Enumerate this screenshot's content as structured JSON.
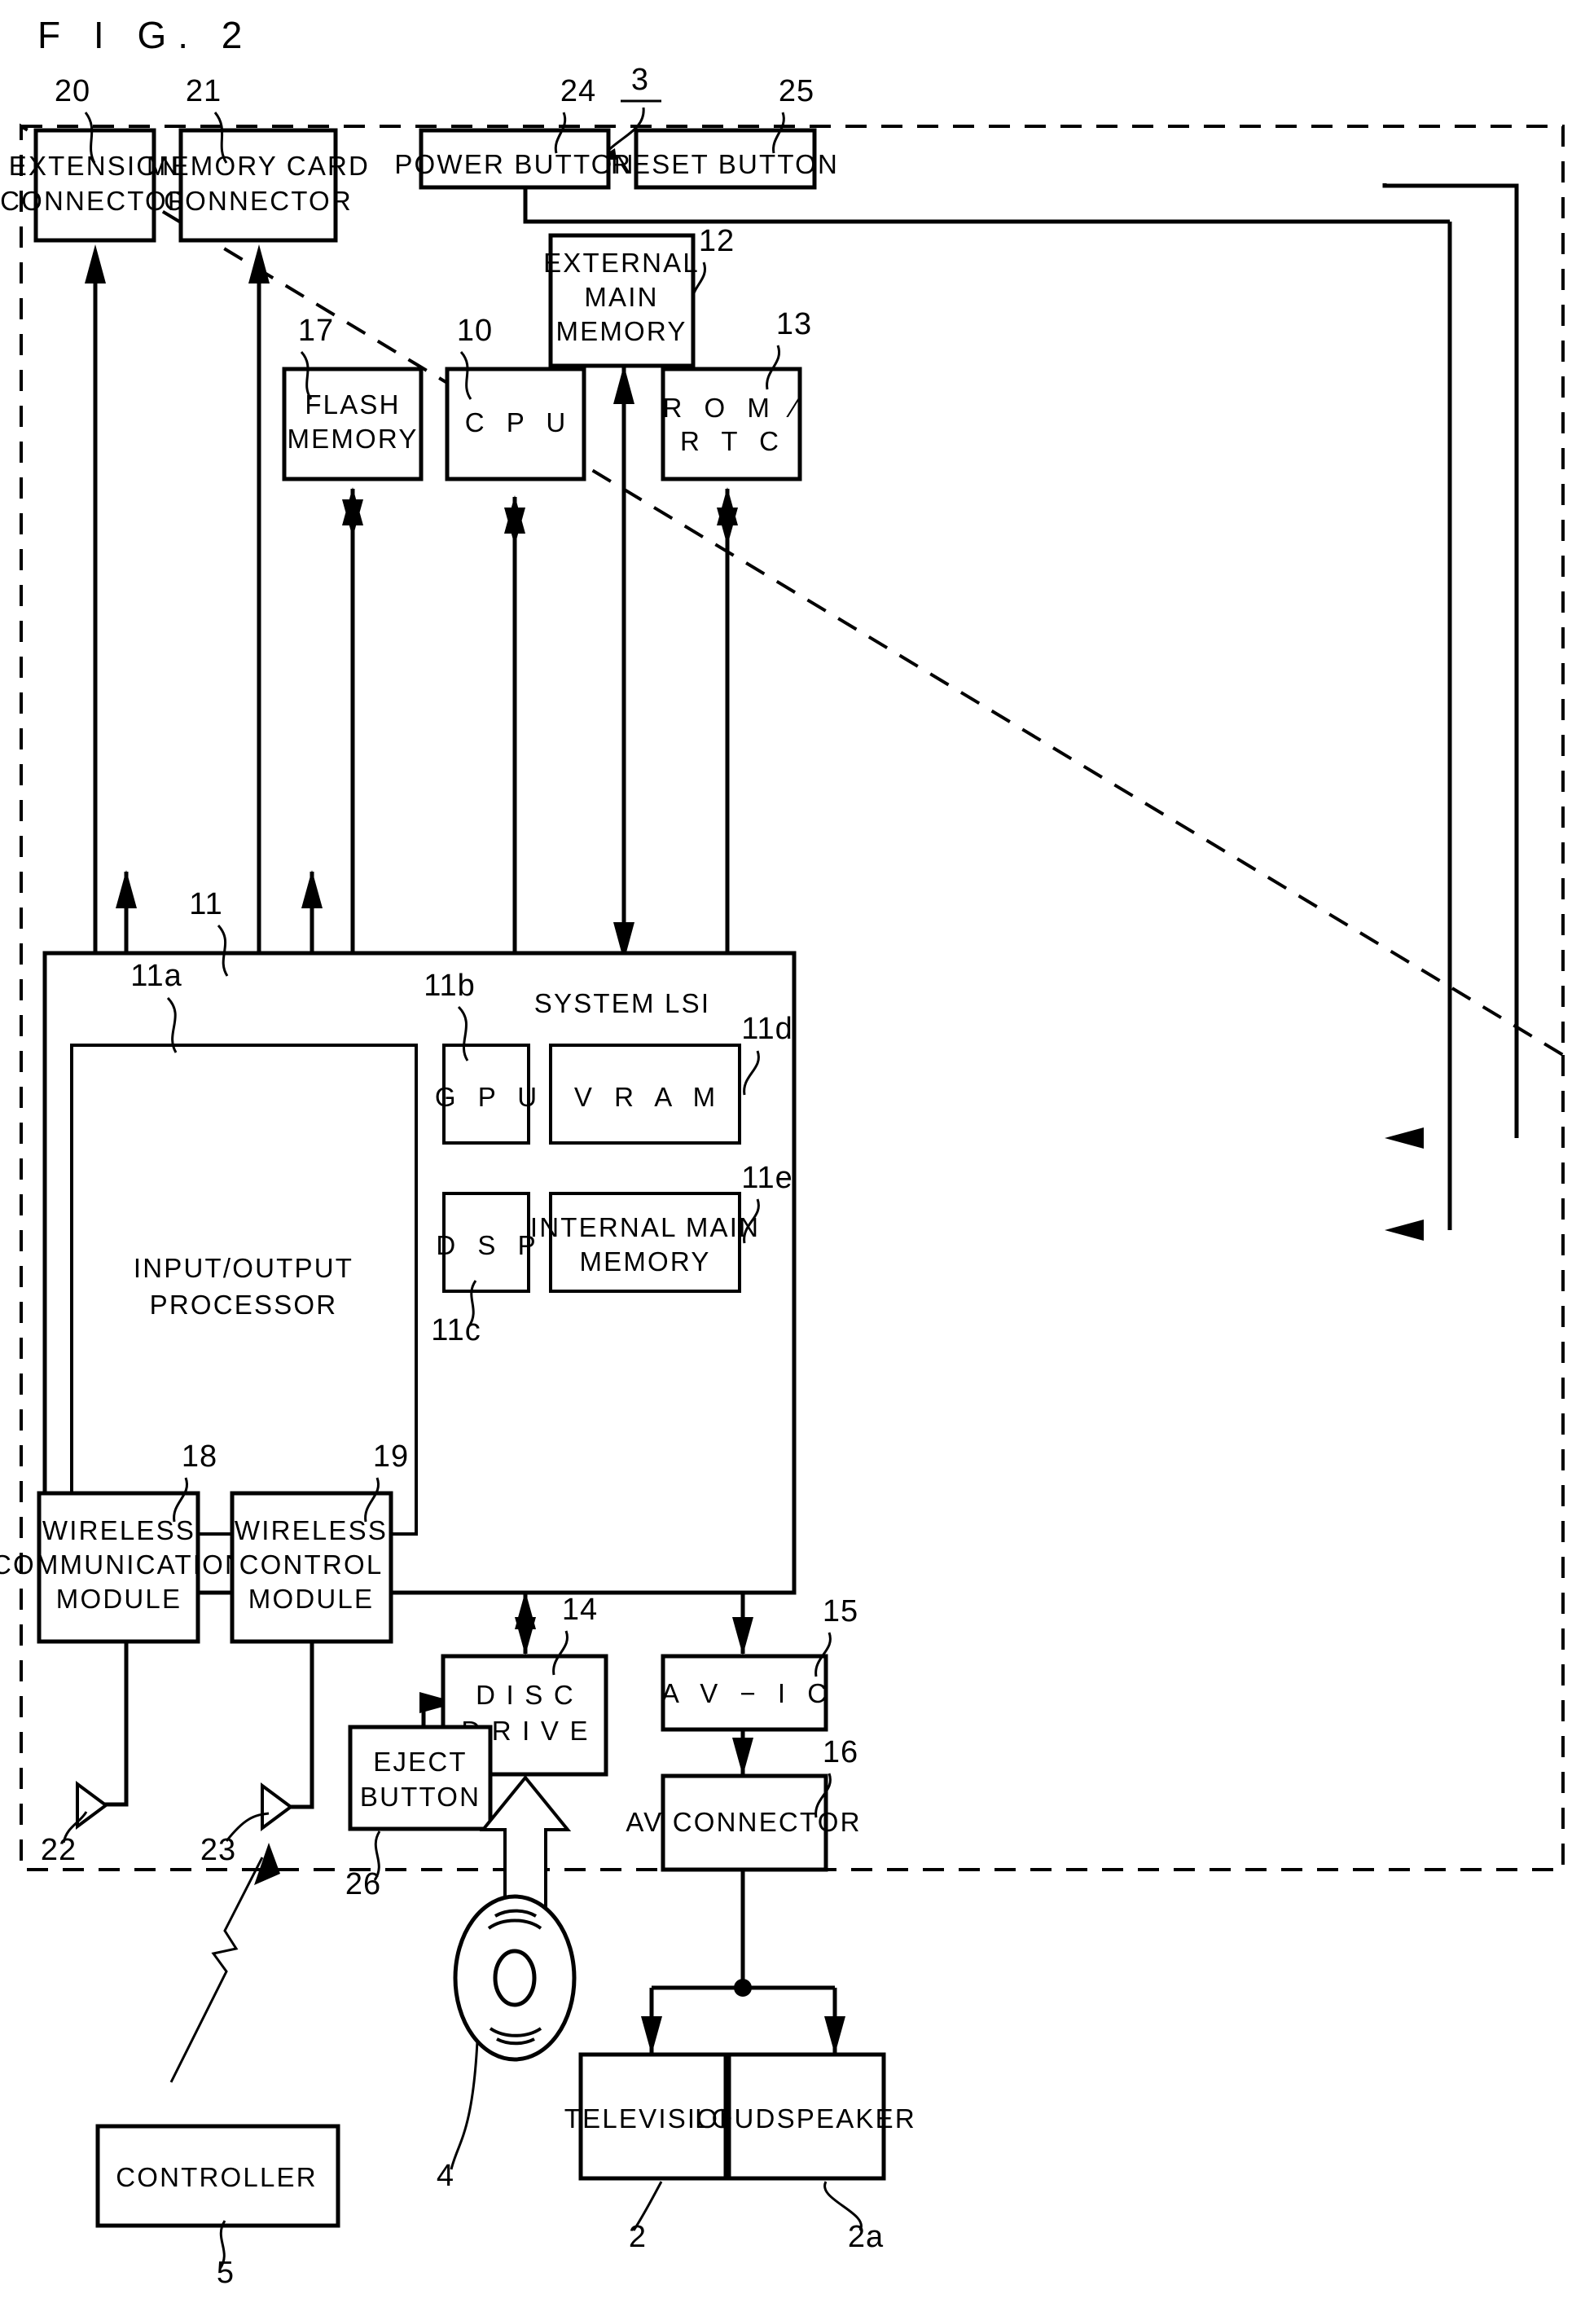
{
  "figure": {
    "title": "F I G.  2",
    "assembly_ref": "3"
  },
  "boxes": {
    "extension_connector": {
      "lines": [
        "EXTENSION",
        "CONNECTOR"
      ],
      "ref": "20"
    },
    "memory_card_connector": {
      "lines": [
        "MEMORY CARD",
        "CONNECTOR"
      ],
      "ref": "21"
    },
    "power_button": {
      "lines": [
        "POWER BUTTON"
      ],
      "ref": "24"
    },
    "reset_button": {
      "lines": [
        "RESET BUTTON"
      ],
      "ref": "25"
    },
    "external_main_memory": {
      "lines": [
        "EXTERNAL",
        "MAIN",
        "MEMORY"
      ],
      "ref": "12"
    },
    "flash_memory": {
      "lines": [
        "FLASH",
        "MEMORY"
      ],
      "ref": "17"
    },
    "cpu": {
      "lines": [
        "C P U"
      ],
      "ref": "10"
    },
    "rom_rtc": {
      "lines": [
        "R O M ∕",
        "R T C"
      ],
      "ref": "13"
    },
    "system_lsi": {
      "lines": [
        "SYSTEM LSI"
      ],
      "ref": "11"
    },
    "input_output_processor": {
      "lines": [
        "INPUT/OUTPUT",
        "PROCESSOR"
      ],
      "ref": "11a"
    },
    "gpu": {
      "lines": [
        "G P U"
      ],
      "ref": "11b"
    },
    "vram": {
      "lines": [
        "V R A M"
      ],
      "ref": "11d"
    },
    "dsp": {
      "lines": [
        "D S P"
      ],
      "ref": "11c"
    },
    "internal_main_memory": {
      "lines": [
        "INTERNAL MAIN",
        "MEMORY"
      ],
      "ref": "11e"
    },
    "wireless_communication_module": {
      "lines": [
        "WIRELESS",
        "COMMUNICATION",
        "MODULE"
      ],
      "ref": "18"
    },
    "wireless_control_module": {
      "lines": [
        "WIRELESS",
        "CONTROL",
        "MODULE"
      ],
      "ref": "19"
    },
    "disc_drive": {
      "lines": [
        "D I S C",
        "D R I V E"
      ],
      "ref": "14"
    },
    "av_ic": {
      "lines": [
        "A V − I C"
      ],
      "ref": "15"
    },
    "av_connector": {
      "lines": [
        "AV CONNECTOR"
      ],
      "ref": "16"
    },
    "eject_button": {
      "lines": [
        "EJECT",
        "BUTTON"
      ],
      "ref": "26"
    },
    "controller": {
      "lines": [
        "CONTROLLER"
      ],
      "ref": "5"
    },
    "television": {
      "lines": [
        "TELEVISION"
      ],
      "ref": "2"
    },
    "loudspeaker": {
      "lines": [
        "LOUDSPEAKER"
      ],
      "ref": "2a"
    }
  },
  "antennas": {
    "antenna_communication_ref": "22",
    "antenna_control_ref": "23"
  },
  "optical_disc": {
    "ref": "4"
  },
  "colors": {
    "ink": "#000000",
    "paper": "#ffffff"
  }
}
